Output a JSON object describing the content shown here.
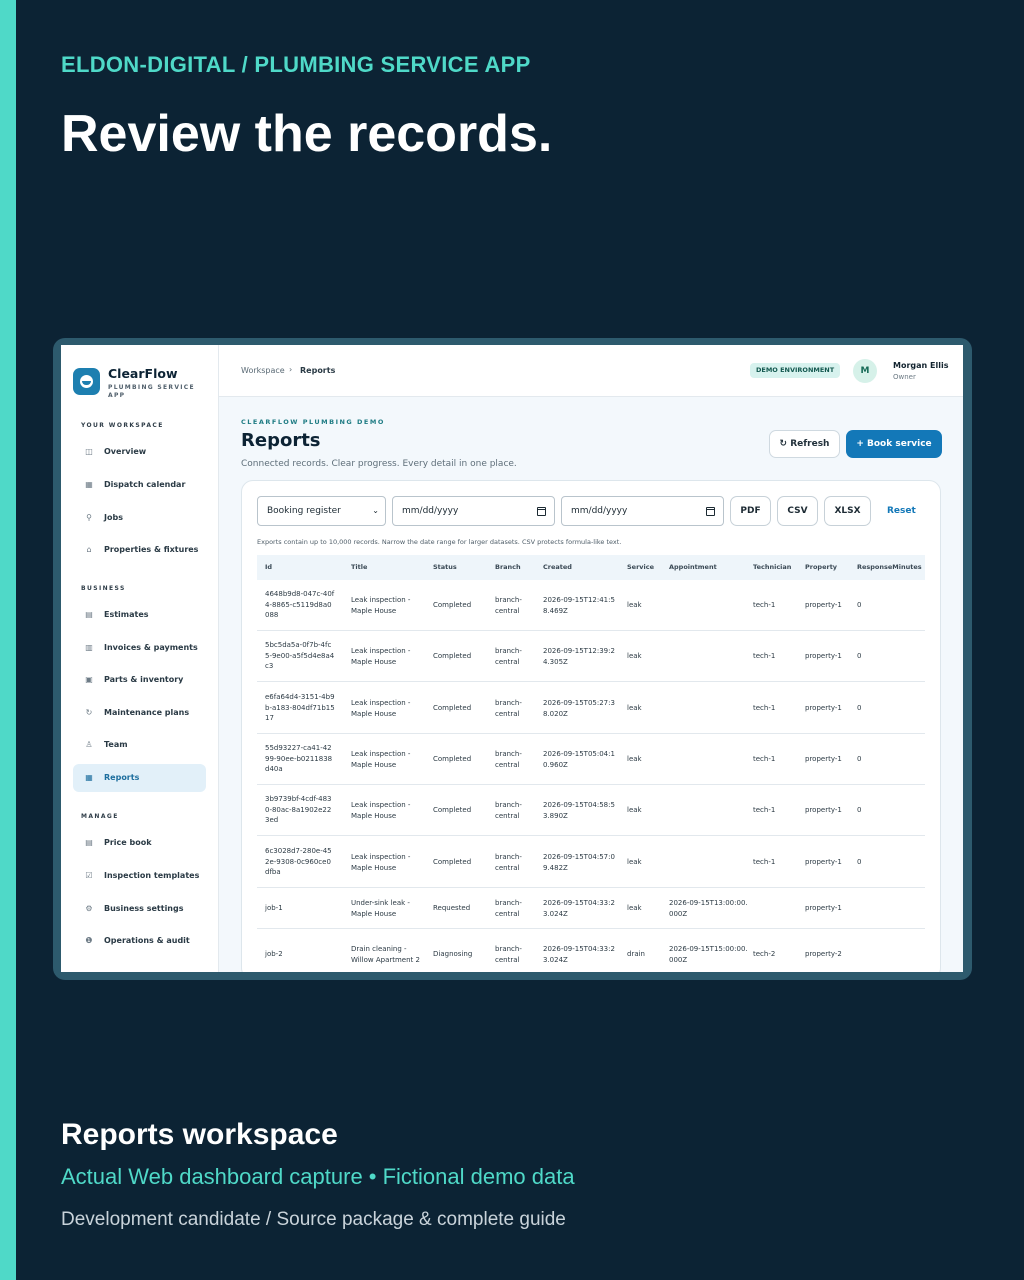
{
  "poster": {
    "eyebrow": "ELDON-DIGITAL  /  PLUMBING SERVICE APP",
    "headline": "Review the records.",
    "bottom_title": "Reports workspace",
    "bottom_subtitle": "Actual Web dashboard capture  •  Fictional demo data",
    "bottom_meta": "Development candidate  /  Source package & complete guide",
    "accent_color": "#4fd9c8",
    "background_color": "#0c2334"
  },
  "sidebar": {
    "brand_name": "ClearFlow",
    "brand_sub": "PLUMBING SERVICE APP",
    "sections": [
      {
        "label": "YOUR WORKSPACE"
      },
      {
        "label": "BUSINESS"
      },
      {
        "label": "MANAGE"
      }
    ],
    "items": [
      {
        "label": "Overview",
        "icon": "grid-icon"
      },
      {
        "label": "Dispatch calendar",
        "icon": "calendar-icon"
      },
      {
        "label": "Jobs",
        "icon": "wrench-icon"
      },
      {
        "label": "Properties & fixtures",
        "icon": "home-icon"
      },
      {
        "label": "Estimates",
        "icon": "estimate-icon"
      },
      {
        "label": "Invoices & payments",
        "icon": "invoice-icon"
      },
      {
        "label": "Parts & inventory",
        "icon": "box-icon"
      },
      {
        "label": "Maintenance plans",
        "icon": "refresh-icon"
      },
      {
        "label": "Team",
        "icon": "person-icon"
      },
      {
        "label": "Reports",
        "icon": "chart-icon",
        "active": true
      },
      {
        "label": "Price book",
        "icon": "book-icon"
      },
      {
        "label": "Inspection templates",
        "icon": "checkbox-icon"
      },
      {
        "label": "Business settings",
        "icon": "gear-icon"
      },
      {
        "label": "Operations & audit",
        "icon": "info-icon"
      }
    ]
  },
  "topbar": {
    "breadcrumb": [
      "Workspace",
      "Reports"
    ],
    "env_badge": "DEMO ENVIRONMENT",
    "avatar_initial": "M",
    "user_name": "Morgan Ellis",
    "user_role": "Owner"
  },
  "main": {
    "kicker": "CLEARFLOW PLUMBING DEMO",
    "title": "Reports",
    "description": "Connected records. Clear progress. Every detail in one place.",
    "refresh_label": "↻ Refresh",
    "book_label": "+ Book service",
    "report_select": "Booking register",
    "date_from_placeholder": "mm/dd/yyyy",
    "date_to_placeholder": "mm/dd/yyyy",
    "export_pdf": "PDF",
    "export_csv": "CSV",
    "export_xlsx": "XLSX",
    "reset_label": "Reset",
    "export_note": "Exports contain up to 10,000 records. Narrow the date range for larger datasets. CSV protects formula-like text.",
    "columns": [
      "Id",
      "Title",
      "Status",
      "Branch",
      "Created",
      "Service",
      "Appointment",
      "Technician",
      "Property",
      "ResponseMinutes"
    ],
    "rows": [
      [
        "4648b9d8-047c-40f4-8865-c5119d8a0088",
        "Leak inspection - Maple House",
        "Completed",
        "branch-central",
        "2026-09-15T12:41:58.469Z",
        "leak",
        "",
        "tech-1",
        "property-1",
        "0"
      ],
      [
        "5bc5da5a-0f7b-4fc5-9e00-a5f5d4e8a4c3",
        "Leak inspection - Maple House",
        "Completed",
        "branch-central",
        "2026-09-15T12:39:24.305Z",
        "leak",
        "",
        "tech-1",
        "property-1",
        "0"
      ],
      [
        "e6fa64d4-3151-4b9b-a183-804df71b1517",
        "Leak inspection - Maple House",
        "Completed",
        "branch-central",
        "2026-09-15T05:27:38.020Z",
        "leak",
        "",
        "tech-1",
        "property-1",
        "0"
      ],
      [
        "55d93227-ca41-4299-90ee-b0211838d40a",
        "Leak inspection - Maple House",
        "Completed",
        "branch-central",
        "2026-09-15T05:04:10.960Z",
        "leak",
        "",
        "tech-1",
        "property-1",
        "0"
      ],
      [
        "3b9739bf-4cdf-4830-80ac-8a1902e223ed",
        "Leak inspection - Maple House",
        "Completed",
        "branch-central",
        "2026-09-15T04:58:53.890Z",
        "leak",
        "",
        "tech-1",
        "property-1",
        "0"
      ],
      [
        "6c3028d7-280e-452e-9308-0c960ce0dfba",
        "Leak inspection - Maple House",
        "Completed",
        "branch-central",
        "2026-09-15T04:57:09.482Z",
        "leak",
        "",
        "tech-1",
        "property-1",
        "0"
      ],
      [
        "job-1",
        "Under-sink leak - Maple House",
        "Requested",
        "branch-central",
        "2026-09-15T04:33:23.024Z",
        "leak",
        "2026-09-15T13:00:00.000Z",
        "",
        "property-1",
        ""
      ],
      [
        "job-2",
        "Drain cleaning - Willow Apartment 2",
        "Diagnosing",
        "branch-central",
        "2026-09-15T04:33:23.024Z",
        "drain",
        "2026-09-15T15:00:00.000Z",
        "tech-2",
        "property-2",
        ""
      ]
    ]
  }
}
